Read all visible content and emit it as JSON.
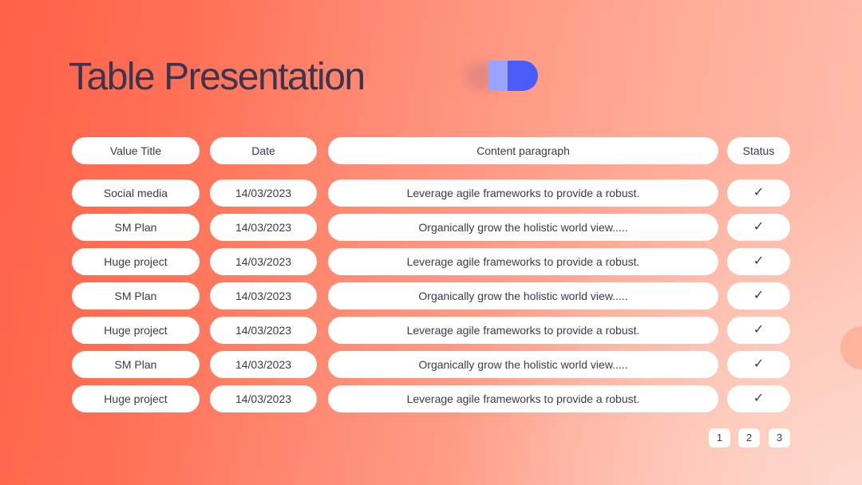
{
  "title": "Table Presentation",
  "table": {
    "headers": [
      "Value Title",
      "Date",
      "Content paragraph",
      "Status"
    ],
    "rows": [
      [
        "Social media",
        "14/03/2023",
        "Leverage agile frameworks to provide a robust.",
        "✓"
      ],
      [
        "SM Plan",
        "14/03/2023",
        "Organically grow the holistic world view.....",
        "✓"
      ],
      [
        "Huge project",
        "14/03/2023",
        "Leverage agile frameworks to provide a robust.",
        "✓"
      ],
      [
        "SM Plan",
        "14/03/2023",
        "Organically grow the holistic world view.....",
        "✓"
      ],
      [
        "Huge project",
        "14/03/2023",
        "Leverage agile frameworks to provide a robust.",
        "✓"
      ],
      [
        "SM Plan",
        "14/03/2023",
        "Organically grow the holistic world view.....",
        "✓"
      ],
      [
        "Huge project",
        "14/03/2023",
        "Leverage agile frameworks to provide a robust.",
        "✓"
      ]
    ]
  },
  "pagination": [
    "1",
    "2",
    "3"
  ],
  "colors": {
    "background_start": "#ff6147",
    "background_end": "#ffc0b0",
    "title_text": "#3a3550",
    "accent_blue": "#4a5cf7",
    "accent_light_blue": "#9aa3ff",
    "cell_background": "#ffffff"
  },
  "icons": {
    "toggle_decoration": "toggle-shape-icon",
    "circle_decoration": "pie-circle-icon",
    "status": "checkmark-icon"
  }
}
